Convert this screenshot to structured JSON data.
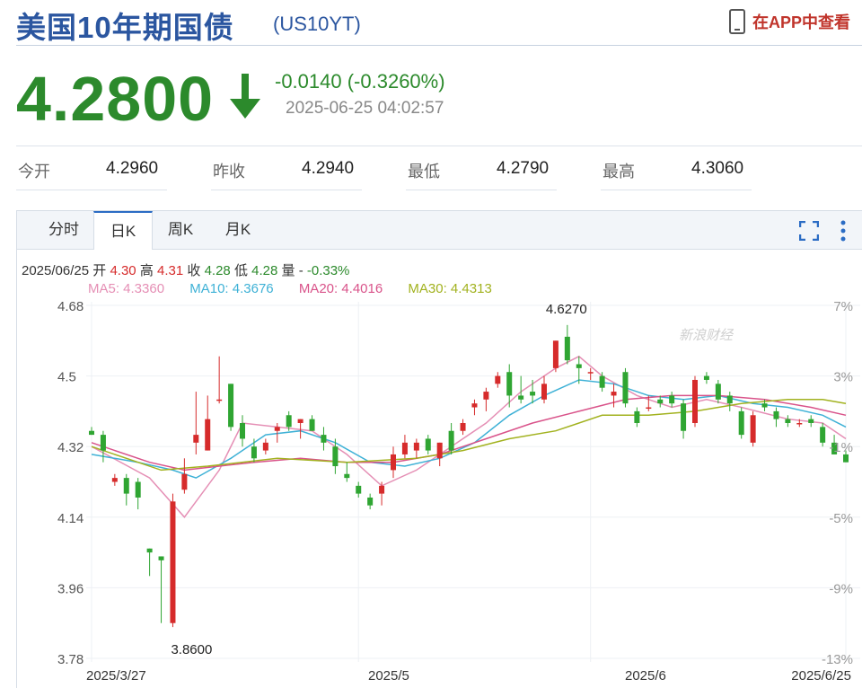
{
  "header": {
    "title": "美国10年期国债",
    "code": "(US10YT)",
    "app_link": "在APP中查看"
  },
  "quote": {
    "price": "4.2800",
    "change": "-0.0140 (-0.3260%)",
    "timestamp": "2025-06-25 04:02:57"
  },
  "stats": [
    {
      "label": "今开",
      "value": "4.2960"
    },
    {
      "label": "昨收",
      "value": "4.2940"
    },
    {
      "label": "最低",
      "value": "4.2790"
    },
    {
      "label": "最高",
      "value": "4.3060"
    }
  ],
  "tabs": [
    "分时",
    "日K",
    "周K",
    "月K"
  ],
  "active_tab": "日K",
  "ohlc_bar": {
    "date": "2025/06/25",
    "open_label": "开",
    "open": "4.30",
    "high_label": "高",
    "high": "4.31",
    "close_label": "收",
    "close": "4.28",
    "low_label": "低",
    "low": "4.28",
    "vol_label": "量",
    "vol": "-",
    "pct": "-0.33%"
  },
  "ma_legend": [
    {
      "label": "MA5: 4.3360",
      "color": "#e58fb5"
    },
    {
      "label": "MA10: 4.3676",
      "color": "#3eb1d6"
    },
    {
      "label": "MA20: 4.4016",
      "color": "#d9538a"
    },
    {
      "label": "MA30: 4.4313",
      "color": "#a2b21f"
    }
  ],
  "colors": {
    "up": "#d62b2b",
    "down": "#2fa532",
    "brand": "#2b56a0",
    "price": "#2c8a2c"
  },
  "watermark": "新浪财经",
  "chart_data": {
    "type": "candlestick",
    "y_ticks": [
      "4.68",
      "4.5",
      "4.32",
      "4.14",
      "3.96",
      "3.78"
    ],
    "pct_ticks": [
      "7%",
      "3%",
      "-1%",
      "-5%",
      "-9%",
      "-13%"
    ],
    "x_ticks": [
      "2025/3/27",
      "2025/5",
      "2025/6",
      "2025/6/25"
    ],
    "ylim": [
      3.78,
      4.68
    ],
    "annotations": [
      {
        "text": "4.6270",
        "value": 4.627
      },
      {
        "text": "3.8600",
        "value": 3.86
      }
    ],
    "candles": [
      {
        "o": 4.36,
        "h": 4.37,
        "l": 4.35,
        "c": 4.35
      },
      {
        "o": 4.35,
        "h": 4.36,
        "l": 4.28,
        "c": 4.31
      },
      {
        "o": 4.23,
        "h": 4.25,
        "l": 4.22,
        "c": 4.24
      },
      {
        "o": 4.24,
        "h": 4.25,
        "l": 4.17,
        "c": 4.2
      },
      {
        "o": 4.23,
        "h": 4.24,
        "l": 4.16,
        "c": 4.19
      },
      {
        "o": 4.06,
        "h": 4.06,
        "l": 3.99,
        "c": 4.05
      },
      {
        "o": 4.04,
        "h": 4.04,
        "l": 3.87,
        "c": 4.03
      },
      {
        "o": 3.87,
        "h": 4.2,
        "l": 3.86,
        "c": 4.18
      },
      {
        "o": 4.21,
        "h": 4.29,
        "l": 4.2,
        "c": 4.25
      },
      {
        "o": 4.33,
        "h": 4.46,
        "l": 4.3,
        "c": 4.35
      },
      {
        "o": 4.31,
        "h": 4.45,
        "l": 4.31,
        "c": 4.39
      },
      {
        "o": 4.44,
        "h": 4.55,
        "l": 4.43,
        "c": 4.44
      },
      {
        "o": 4.48,
        "h": 4.48,
        "l": 4.36,
        "c": 4.37
      },
      {
        "o": 4.38,
        "h": 4.4,
        "l": 4.32,
        "c": 4.34
      },
      {
        "o": 4.32,
        "h": 4.34,
        "l": 4.28,
        "c": 4.29
      },
      {
        "o": 4.31,
        "h": 4.34,
        "l": 4.3,
        "c": 4.33
      },
      {
        "o": 4.36,
        "h": 4.38,
        "l": 4.33,
        "c": 4.37
      },
      {
        "o": 4.4,
        "h": 4.41,
        "l": 4.36,
        "c": 4.37
      },
      {
        "o": 4.38,
        "h": 4.39,
        "l": 4.34,
        "c": 4.39
      },
      {
        "o": 4.39,
        "h": 4.4,
        "l": 4.36,
        "c": 4.36
      },
      {
        "o": 4.35,
        "h": 4.37,
        "l": 4.31,
        "c": 4.33
      },
      {
        "o": 4.32,
        "h": 4.34,
        "l": 4.25,
        "c": 4.27
      },
      {
        "o": 4.25,
        "h": 4.28,
        "l": 4.23,
        "c": 4.24
      },
      {
        "o": 4.22,
        "h": 4.23,
        "l": 4.19,
        "c": 4.2
      },
      {
        "o": 4.19,
        "h": 4.2,
        "l": 4.16,
        "c": 4.17
      },
      {
        "o": 4.2,
        "h": 4.23,
        "l": 4.17,
        "c": 4.22
      },
      {
        "o": 4.26,
        "h": 4.32,
        "l": 4.24,
        "c": 4.3
      },
      {
        "o": 4.3,
        "h": 4.35,
        "l": 4.29,
        "c": 4.33
      },
      {
        "o": 4.31,
        "h": 4.34,
        "l": 4.29,
        "c": 4.33
      },
      {
        "o": 4.34,
        "h": 4.35,
        "l": 4.3,
        "c": 4.31
      },
      {
        "o": 4.29,
        "h": 4.33,
        "l": 4.27,
        "c": 4.33
      },
      {
        "o": 4.36,
        "h": 4.38,
        "l": 4.3,
        "c": 4.31
      },
      {
        "o": 4.36,
        "h": 4.39,
        "l": 4.35,
        "c": 4.38
      },
      {
        "o": 4.42,
        "h": 4.44,
        "l": 4.4,
        "c": 4.43
      },
      {
        "o": 4.44,
        "h": 4.47,
        "l": 4.41,
        "c": 4.46
      },
      {
        "o": 4.48,
        "h": 4.51,
        "l": 4.47,
        "c": 4.5
      },
      {
        "o": 4.51,
        "h": 4.53,
        "l": 4.42,
        "c": 4.45
      },
      {
        "o": 4.45,
        "h": 4.5,
        "l": 4.43,
        "c": 4.44
      },
      {
        "o": 4.46,
        "h": 4.49,
        "l": 4.43,
        "c": 4.45
      },
      {
        "o": 4.44,
        "h": 4.5,
        "l": 4.43,
        "c": 4.48
      },
      {
        "o": 4.52,
        "h": 4.59,
        "l": 4.51,
        "c": 4.59
      },
      {
        "o": 4.6,
        "h": 4.63,
        "l": 4.53,
        "c": 4.54
      },
      {
        "o": 4.53,
        "h": 4.55,
        "l": 4.48,
        "c": 4.52
      },
      {
        "o": 4.51,
        "h": 4.52,
        "l": 4.49,
        "c": 4.51
      },
      {
        "o": 4.5,
        "h": 4.51,
        "l": 4.46,
        "c": 4.47
      },
      {
        "o": 4.45,
        "h": 4.48,
        "l": 4.42,
        "c": 4.46
      },
      {
        "o": 4.51,
        "h": 4.52,
        "l": 4.42,
        "c": 4.43
      },
      {
        "o": 4.41,
        "h": 4.42,
        "l": 4.37,
        "c": 4.38
      },
      {
        "o": 4.42,
        "h": 4.45,
        "l": 4.41,
        "c": 4.42
      },
      {
        "o": 4.44,
        "h": 4.45,
        "l": 4.42,
        "c": 4.43
      },
      {
        "o": 4.45,
        "h": 4.46,
        "l": 4.42,
        "c": 4.43
      },
      {
        "o": 4.43,
        "h": 4.44,
        "l": 4.34,
        "c": 4.36
      },
      {
        "o": 4.38,
        "h": 4.5,
        "l": 4.37,
        "c": 4.49
      },
      {
        "o": 4.5,
        "h": 4.51,
        "l": 4.48,
        "c": 4.49
      },
      {
        "o": 4.48,
        "h": 4.49,
        "l": 4.43,
        "c": 4.44
      },
      {
        "o": 4.45,
        "h": 4.46,
        "l": 4.41,
        "c": 4.43
      },
      {
        "o": 4.41,
        "h": 4.42,
        "l": 4.34,
        "c": 4.35
      },
      {
        "o": 4.33,
        "h": 4.41,
        "l": 4.32,
        "c": 4.4
      },
      {
        "o": 4.43,
        "h": 4.44,
        "l": 4.41,
        "c": 4.42
      },
      {
        "o": 4.41,
        "h": 4.42,
        "l": 4.37,
        "c": 4.39
      },
      {
        "o": 4.39,
        "h": 4.4,
        "l": 4.37,
        "c": 4.38
      },
      {
        "o": 4.38,
        "h": 4.39,
        "l": 4.37,
        "c": 4.38
      },
      {
        "o": 4.39,
        "h": 4.4,
        "l": 4.37,
        "c": 4.38
      },
      {
        "o": 4.37,
        "h": 4.38,
        "l": 4.32,
        "c": 4.33
      },
      {
        "o": 4.33,
        "h": 4.35,
        "l": 4.3,
        "c": 4.3
      },
      {
        "o": 4.3,
        "h": 4.31,
        "l": 4.28,
        "c": 4.28
      }
    ],
    "ma": {
      "MA5": [
        [
          0,
          4.32
        ],
        [
          5,
          4.24
        ],
        [
          8,
          4.14
        ],
        [
          11,
          4.26
        ],
        [
          13,
          4.38
        ],
        [
          16,
          4.37
        ],
        [
          19,
          4.36
        ],
        [
          22,
          4.3
        ],
        [
          25,
          4.22
        ],
        [
          28,
          4.26
        ],
        [
          31,
          4.32
        ],
        [
          34,
          4.38
        ],
        [
          37,
          4.46
        ],
        [
          40,
          4.52
        ],
        [
          42,
          4.55
        ],
        [
          44,
          4.5
        ],
        [
          47,
          4.45
        ],
        [
          50,
          4.42
        ],
        [
          53,
          4.44
        ],
        [
          56,
          4.42
        ],
        [
          60,
          4.39
        ],
        [
          63,
          4.38
        ],
        [
          65,
          4.34
        ]
      ],
      "MA10": [
        [
          0,
          4.3
        ],
        [
          4,
          4.28
        ],
        [
          7,
          4.26
        ],
        [
          9,
          4.24
        ],
        [
          12,
          4.29
        ],
        [
          15,
          4.35
        ],
        [
          18,
          4.36
        ],
        [
          21,
          4.33
        ],
        [
          24,
          4.28
        ],
        [
          27,
          4.27
        ],
        [
          30,
          4.29
        ],
        [
          33,
          4.33
        ],
        [
          36,
          4.4
        ],
        [
          39,
          4.45
        ],
        [
          42,
          4.49
        ],
        [
          45,
          4.48
        ],
        [
          48,
          4.45
        ],
        [
          51,
          4.44
        ],
        [
          54,
          4.45
        ],
        [
          57,
          4.43
        ],
        [
          60,
          4.42
        ],
        [
          63,
          4.4
        ],
        [
          65,
          4.37
        ]
      ],
      "MA20": [
        [
          0,
          4.33
        ],
        [
          5,
          4.28
        ],
        [
          8,
          4.26
        ],
        [
          11,
          4.27
        ],
        [
          14,
          4.28
        ],
        [
          18,
          4.29
        ],
        [
          22,
          4.28
        ],
        [
          26,
          4.28
        ],
        [
          30,
          4.3
        ],
        [
          34,
          4.34
        ],
        [
          38,
          4.38
        ],
        [
          42,
          4.41
        ],
        [
          46,
          4.44
        ],
        [
          50,
          4.45
        ],
        [
          54,
          4.45
        ],
        [
          58,
          4.44
        ],
        [
          62,
          4.42
        ],
        [
          65,
          4.4
        ]
      ],
      "MA30": [
        [
          0,
          4.32
        ],
        [
          6,
          4.26
        ],
        [
          10,
          4.27
        ],
        [
          16,
          4.29
        ],
        [
          22,
          4.28
        ],
        [
          28,
          4.29
        ],
        [
          32,
          4.31
        ],
        [
          36,
          4.34
        ],
        [
          40,
          4.36
        ],
        [
          44,
          4.4
        ],
        [
          48,
          4.4
        ],
        [
          52,
          4.41
        ],
        [
          56,
          4.43
        ],
        [
          60,
          4.44
        ],
        [
          63,
          4.44
        ],
        [
          65,
          4.43
        ]
      ]
    }
  }
}
